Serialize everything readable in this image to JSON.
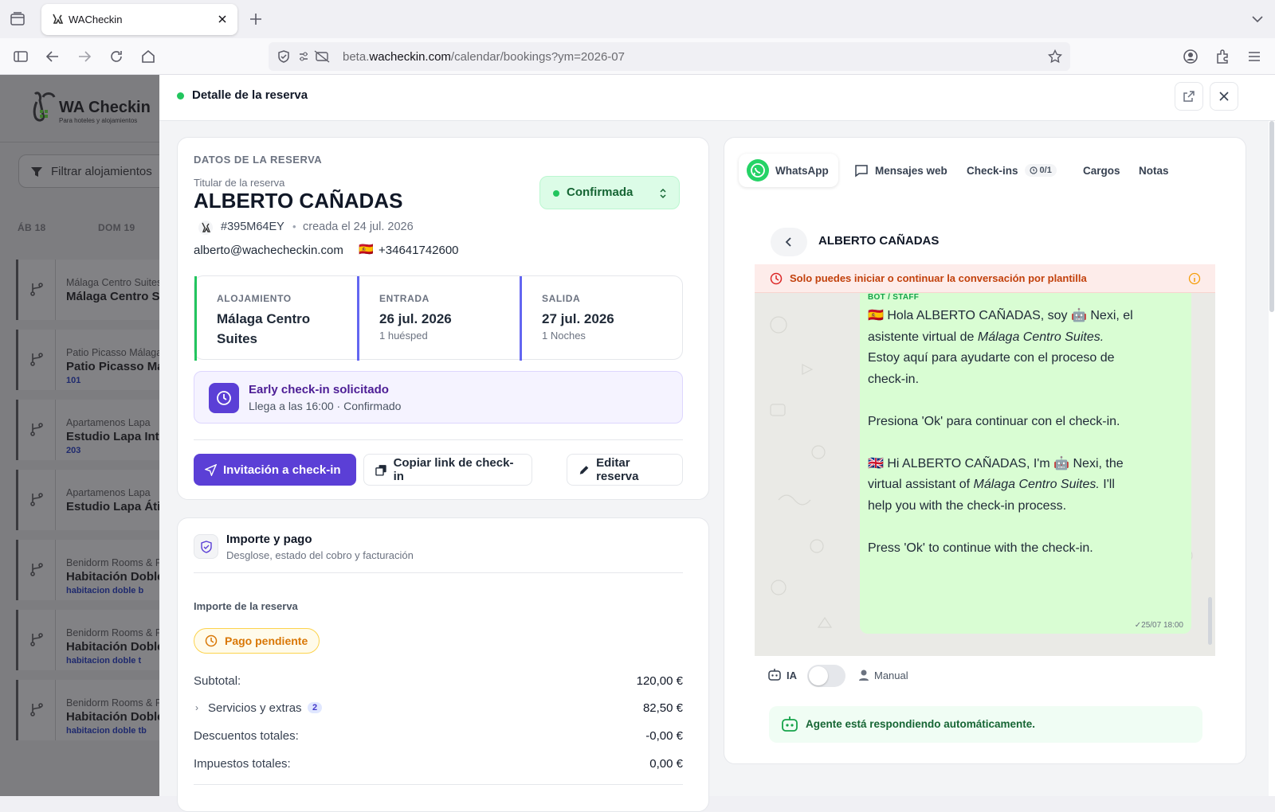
{
  "browser": {
    "tab_title": "WACheckin",
    "url_prefix": "beta.",
    "url_domain": "wacheckin.com",
    "url_path": "/calendar/bookings?ym=2026-07"
  },
  "bg": {
    "logo_title": "WA Checkin",
    "logo_sub": "Para hoteles y alojamientos",
    "filter": "Filtrar alojamientos",
    "day1": "ÁB 18",
    "day2": "DOM 19",
    "props": [
      {
        "a": "Málaga Centro Suites",
        "b": "Málaga Centro Suites",
        "c": ""
      },
      {
        "a": "Patio Picasso Málaga",
        "b": "Patio Picasso Málaga",
        "c": "101"
      },
      {
        "a": "Apartamenos Lapa",
        "b": "Estudio Lapa Interior",
        "c": "203"
      },
      {
        "a": "Apartamenos Lapa",
        "b": "Estudio Lapa Ático",
        "c": ""
      },
      {
        "a": "Benidorm Rooms & Flats",
        "b": "Habitación Doble",
        "c": "habitacion doble b"
      },
      {
        "a": "Benidorm Rooms & Flats",
        "b": "Habitación Doble",
        "c": "habitacion doble t"
      },
      {
        "a": "Benidorm Rooms & Flats",
        "b": "Habitación Doble",
        "c": "habitacion doble tb"
      }
    ]
  },
  "panel": {
    "title": "Detalle de la reserva"
  },
  "booking": {
    "section": "DATOS DE LA RESERVA",
    "holder_label": "Titular de la reserva",
    "holder": "ALBERTO CAÑADAS",
    "code": "#395M64EY",
    "sep": "•",
    "created": "creada el 24 jul. 2026",
    "email": "alberto@wachecheckin.com",
    "flag": "🇪🇸",
    "phone": "+34641742600",
    "status": "Confirmada",
    "acc_label": "ALOJAMIENTO",
    "acc_value": "Málaga Centro Suites",
    "in_label": "ENTRADA",
    "in_value": "26 jul. 2026",
    "in_sub": "1 huésped",
    "out_label": "SALIDA",
    "out_value": "27 jul. 2026",
    "out_sub": "1 Noches",
    "early_title": "Early check-in solicitado",
    "early_sub": "Llega a las 16:00 · Confirmado",
    "btn_invite": "Invitación a check-in",
    "btn_copy": "Copiar link de check-in",
    "btn_edit": "Editar reserva"
  },
  "payment": {
    "title": "Importe y pago",
    "subtitle": "Desglose, estado del cobro y facturación",
    "section": "Importe de la reserva",
    "badge": "Pago pendiente",
    "subtotal_label": "Subtotal:",
    "subtotal": "120,00 €",
    "extras_label": "Servicios y extras",
    "extras_count": "2",
    "extras": "82,50 €",
    "discounts_label": "Descuentos totales:",
    "discounts": "-0,00 €",
    "taxes_label": "Impuestos totales:",
    "taxes": "0,00 €"
  },
  "chat": {
    "tabs": {
      "whatsapp": "WhatsApp",
      "web": "Mensajes web",
      "checkins": "Check-ins",
      "checkins_count": "0/1",
      "charges": "Cargos",
      "notes": "Notas"
    },
    "contact": "ALBERTO CAÑADAS",
    "warning": "Solo puedes iniciar o continuar la conversación por plantilla",
    "sender": "BOT / STAFF",
    "es_flag": "🇪🇸",
    "robot": "🤖",
    "gb_flag": "🇬🇧",
    "es_hello": "Hola ALBERTO CAÑADAS, soy",
    "es_name": "Nexi, el asistente virtual de",
    "es_place": "Málaga Centro Suites.",
    "es_rest": "Estoy aquí para ayudarte con el proceso de check-in.",
    "es_ok": "Presiona 'Ok' para continuar con el check-in.",
    "en_hello": "Hi ALBERTO CAÑADAS, I'm",
    "en_name": "Nexi, the virtual assistant of",
    "en_place": "Málaga Centro Suites.",
    "en_rest": "I'll help you with the check-in process.",
    "en_ok": "Press 'Ok' to continue with the check-in.",
    "time": "✓25/07 18:00",
    "ia": "IA",
    "ia_enabled": false,
    "manual": "Manual",
    "auto": "Agente está respondiendo automáticamente."
  }
}
